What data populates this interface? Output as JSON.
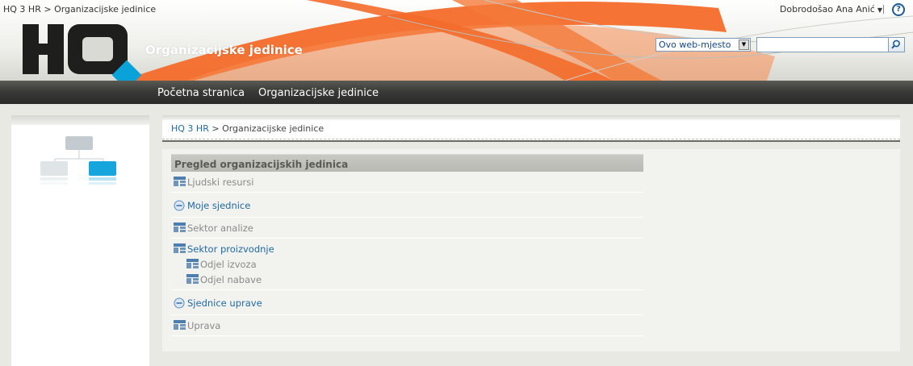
{
  "topbar": {
    "global_breadcrumb_root": "HQ 3 HR",
    "global_breadcrumb_separator": ">",
    "global_breadcrumb_current": "Organizacijske jedinice",
    "welcome": "Dobrodošao Ana Anić",
    "help_label": "?"
  },
  "site": {
    "title": "Organizacijske jedinice"
  },
  "search": {
    "scope": "Ovo web-mjesto",
    "query": ""
  },
  "nav": {
    "items": [
      {
        "label": "Početna stranica"
      },
      {
        "label": "Organizacijske jedinice"
      }
    ]
  },
  "breadcrumb": {
    "root": "HQ 3 HR",
    "separator": ">",
    "current": "Organizacijske jedinice"
  },
  "org_panel": {
    "header": "Pregled organizacijskih jedinica",
    "items": [
      {
        "label": "Ljudski resursi",
        "icon": "org-unit-icon",
        "style": "muted"
      },
      {
        "label": "Moje sjednice",
        "icon": "meeting-icon",
        "style": "link"
      },
      {
        "label": "Sektor analize",
        "icon": "org-unit-icon",
        "style": "muted"
      },
      {
        "label": "Sektor proizvodnje",
        "icon": "org-unit-icon",
        "style": "link",
        "children": [
          {
            "label": "Odjel izvoza",
            "icon": "org-unit-icon",
            "style": "muted"
          },
          {
            "label": "Odjel nabave",
            "icon": "org-unit-icon",
            "style": "muted"
          }
        ]
      },
      {
        "label": "Sjednice uprave",
        "icon": "meeting-icon",
        "style": "link"
      },
      {
        "label": "Uprava",
        "icon": "org-unit-icon",
        "style": "muted"
      }
    ]
  },
  "colors": {
    "link": "#1f6aa6",
    "muted": "#8a8a8a",
    "accent_orange": "#f26522",
    "accent_cyan": "#0aa3d9"
  }
}
